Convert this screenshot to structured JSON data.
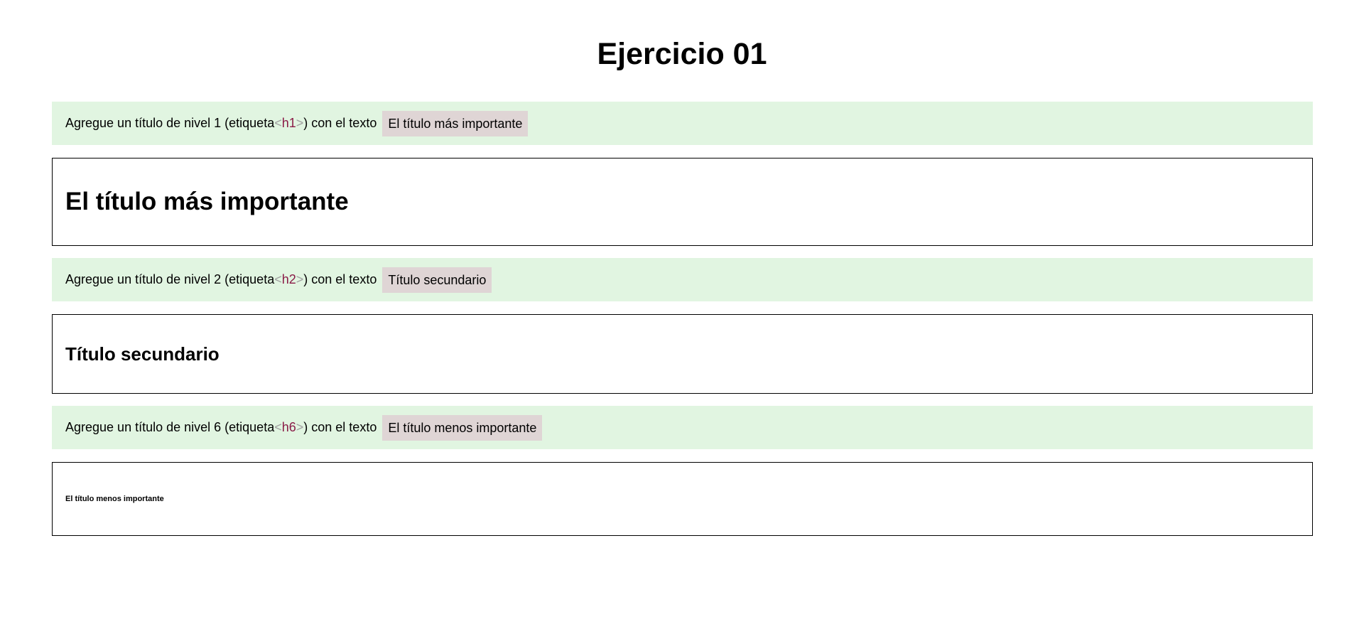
{
  "page": {
    "title": "Ejercicio 01"
  },
  "colors": {
    "instruction_bg": "#e1f5e1",
    "code_bg": "#dfd5d5",
    "tag_name": "#8a1b47",
    "tag_bracket": "#a0a0a0"
  },
  "exercises": [
    {
      "prefix": "Agregue un título de nivel 1 (etiqueta ",
      "bracket_open": "<",
      "tag": "h1",
      "bracket_close": ">",
      "suffix": ") con el texto",
      "code_text": "El título más importante",
      "result_text": "El título más importante"
    },
    {
      "prefix": "Agregue un título de nivel 2 (etiqueta ",
      "bracket_open": "<",
      "tag": "h2",
      "bracket_close": ">",
      "suffix": ") con el texto",
      "code_text": "Título secundario",
      "result_text": "Título secundario"
    },
    {
      "prefix": "Agregue un título de nivel 6 (etiqueta ",
      "bracket_open": "<",
      "tag": "h6",
      "bracket_close": ">",
      "suffix": ") con el texto",
      "code_text": "El título menos importante",
      "result_text": "El título menos importante"
    }
  ]
}
